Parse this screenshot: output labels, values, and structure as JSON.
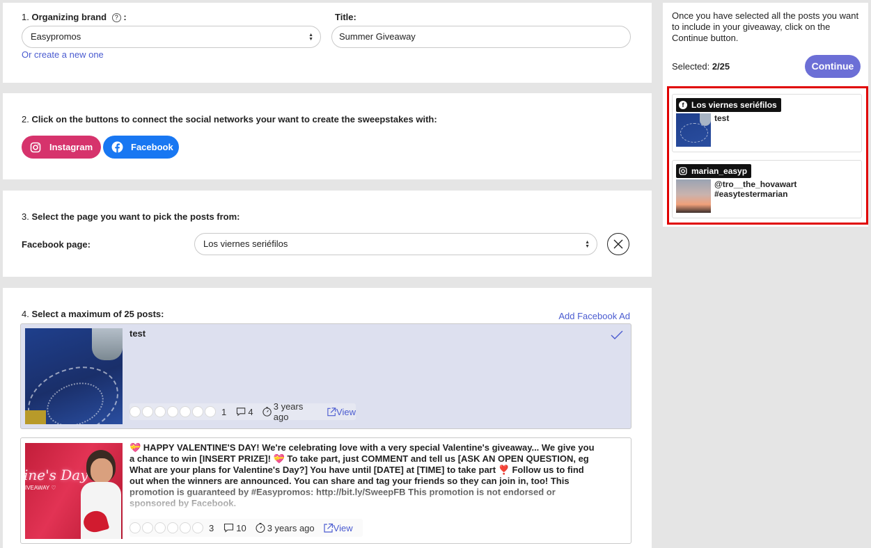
{
  "step1": {
    "brand_label_num": "1.",
    "brand_label": "Organizing brand",
    "brand_help_icon": "?",
    "brand_colon": ":",
    "brand_value": "Easypromos",
    "create_link": "Or create a new one",
    "title_label": "Title:",
    "title_value": "Summer Giveaway"
  },
  "step2": {
    "num": "2.",
    "text": "Click on the buttons to connect the social networks your want to create the sweepstakes with:",
    "instagram_label": "Instagram",
    "facebook_label": "Facebook"
  },
  "step3": {
    "num": "3.",
    "text": "Select the page you want to pick the posts from:",
    "page_label": "Facebook page:",
    "page_value": "Los viernes seriéfilos"
  },
  "step4": {
    "num": "4.",
    "text": "Select a maximum of 25 posts:",
    "add_ad_link": "Add Facebook Ad",
    "posts": [
      {
        "text": "test",
        "reactions": "1",
        "comments": "4",
        "age": "3 years ago",
        "view": "View",
        "selected": true
      },
      {
        "text": "💝 HAPPY VALENTINE'S DAY! We're celebrating love with a very special Valentine's giveaway... We give you a chance to win [INSERT PRIZE]! 💝 To take part, just COMMENT and tell us [ASK AN OPEN QUESTION, eg What are your plans for Valentine's Day?] You have until [DATE] at [TIME] to take part ❣️ Follow us to find out when the winners are announced. You can share and tag your friends so they can join in, too! This promotion is guaranteed by #Easypromos: http://bit.ly/SweepFB This promotion is not endorsed or sponsored by Facebook.",
        "thumb_text": "ine's Day",
        "thumb_sub": "IVEAWAY ♡",
        "reactions": "3",
        "comments": "10",
        "age": "3 years ago",
        "view": "View",
        "selected": false
      }
    ]
  },
  "sidebar": {
    "instructions": "Once you have selected all the posts you want to include in your giveaway, click on the Continue button.",
    "selected_label": "Selected:",
    "selected_value": "2/25",
    "continue_label": "Continue",
    "cards": [
      {
        "network": "facebook",
        "source": "Los viernes seriéfilos",
        "text": "test"
      },
      {
        "network": "instagram",
        "source": "marian_easyp",
        "text_line1": "@tro__the_hovawart",
        "text_line2": "#easytestermarian"
      }
    ]
  },
  "colors": {
    "accent": "#6c6fd6",
    "instagram": "#d6336c",
    "facebook": "#1877f2",
    "highlight": "#e00000",
    "selected_bg": "#dde0ef"
  }
}
